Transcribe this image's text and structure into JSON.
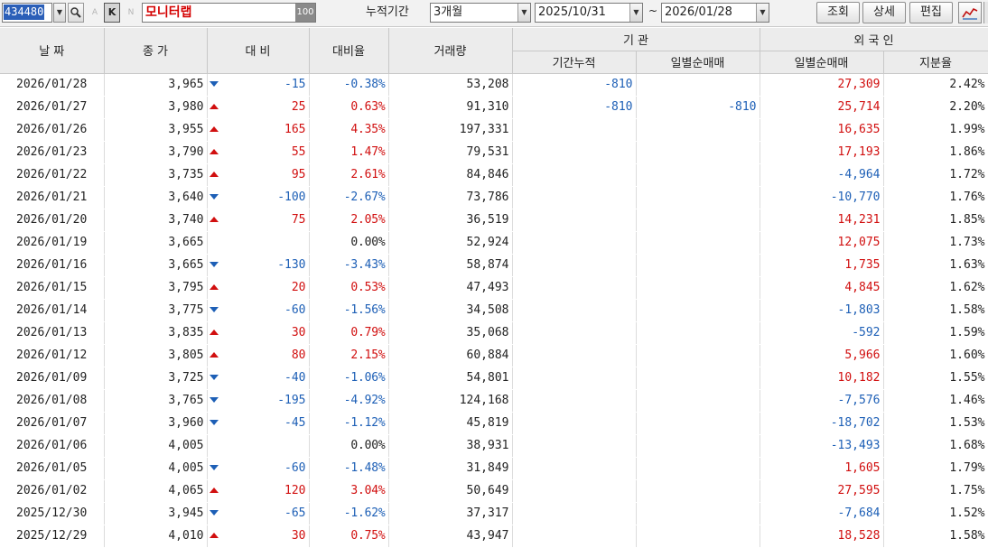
{
  "toolbar": {
    "stock_code": "434480",
    "stock_name": "모니터랩",
    "zoom": "100",
    "ghost_a": "A",
    "k_label": "K",
    "ghost_n": "N",
    "period_label": "누적기간",
    "period_value": "3개월",
    "date_from": "2025/10/31",
    "date_to": "2026/01/28",
    "tilde": "~",
    "btn_search": "조회",
    "btn_detail": "상세",
    "btn_edit": "편집"
  },
  "headers": {
    "date": "날 짜",
    "close": "종 가",
    "change": "대 비",
    "change_rate": "대비율",
    "volume": "거래량",
    "institution": "기 관",
    "inst_cumulative": "기간누적",
    "inst_daily": "일별순매매",
    "foreign": "외 국 인",
    "foreign_daily": "일별순매매",
    "foreign_ratio": "지분율"
  },
  "colors": {
    "up": "#d10f0f",
    "down": "#1d5fb6"
  },
  "rows": [
    {
      "date": "2026/01/28",
      "close": "3,965",
      "dir": "down",
      "change": "-15",
      "rate": "-0.38%",
      "volume": "53,208",
      "inst_cum": "-810",
      "inst_daily": "",
      "frgn_daily": "27,309",
      "frgn_dir": "up",
      "frgn_ratio": "2.42%"
    },
    {
      "date": "2026/01/27",
      "close": "3,980",
      "dir": "up",
      "change": "25",
      "rate": "0.63%",
      "volume": "91,310",
      "inst_cum": "-810",
      "inst_daily": "-810",
      "frgn_daily": "25,714",
      "frgn_dir": "up",
      "frgn_ratio": "2.20%"
    },
    {
      "date": "2026/01/26",
      "close": "3,955",
      "dir": "up",
      "change": "165",
      "rate": "4.35%",
      "volume": "197,331",
      "inst_cum": "",
      "inst_daily": "",
      "frgn_daily": "16,635",
      "frgn_dir": "up",
      "frgn_ratio": "1.99%"
    },
    {
      "date": "2026/01/23",
      "close": "3,790",
      "dir": "up",
      "change": "55",
      "rate": "1.47%",
      "volume": "79,531",
      "inst_cum": "",
      "inst_daily": "",
      "frgn_daily": "17,193",
      "frgn_dir": "up",
      "frgn_ratio": "1.86%"
    },
    {
      "date": "2026/01/22",
      "close": "3,735",
      "dir": "up",
      "change": "95",
      "rate": "2.61%",
      "volume": "84,846",
      "inst_cum": "",
      "inst_daily": "",
      "frgn_daily": "-4,964",
      "frgn_dir": "down",
      "frgn_ratio": "1.72%"
    },
    {
      "date": "2026/01/21",
      "close": "3,640",
      "dir": "down",
      "change": "-100",
      "rate": "-2.67%",
      "volume": "73,786",
      "inst_cum": "",
      "inst_daily": "",
      "frgn_daily": "-10,770",
      "frgn_dir": "down",
      "frgn_ratio": "1.76%"
    },
    {
      "date": "2026/01/20",
      "close": "3,740",
      "dir": "up",
      "change": "75",
      "rate": "2.05%",
      "volume": "36,519",
      "inst_cum": "",
      "inst_daily": "",
      "frgn_daily": "14,231",
      "frgn_dir": "up",
      "frgn_ratio": "1.85%"
    },
    {
      "date": "2026/01/19",
      "close": "3,665",
      "dir": "flat",
      "change": "",
      "rate": "0.00%",
      "volume": "52,924",
      "inst_cum": "",
      "inst_daily": "",
      "frgn_daily": "12,075",
      "frgn_dir": "up",
      "frgn_ratio": "1.73%"
    },
    {
      "date": "2026/01/16",
      "close": "3,665",
      "dir": "down",
      "change": "-130",
      "rate": "-3.43%",
      "volume": "58,874",
      "inst_cum": "",
      "inst_daily": "",
      "frgn_daily": "1,735",
      "frgn_dir": "up",
      "frgn_ratio": "1.63%"
    },
    {
      "date": "2026/01/15",
      "close": "3,795",
      "dir": "up",
      "change": "20",
      "rate": "0.53%",
      "volume": "47,493",
      "inst_cum": "",
      "inst_daily": "",
      "frgn_daily": "4,845",
      "frgn_dir": "up",
      "frgn_ratio": "1.62%"
    },
    {
      "date": "2026/01/14",
      "close": "3,775",
      "dir": "down",
      "change": "-60",
      "rate": "-1.56%",
      "volume": "34,508",
      "inst_cum": "",
      "inst_daily": "",
      "frgn_daily": "-1,803",
      "frgn_dir": "down",
      "frgn_ratio": "1.58%"
    },
    {
      "date": "2026/01/13",
      "close": "3,835",
      "dir": "up",
      "change": "30",
      "rate": "0.79%",
      "volume": "35,068",
      "inst_cum": "",
      "inst_daily": "",
      "frgn_daily": "-592",
      "frgn_dir": "down",
      "frgn_ratio": "1.59%"
    },
    {
      "date": "2026/01/12",
      "close": "3,805",
      "dir": "up",
      "change": "80",
      "rate": "2.15%",
      "volume": "60,884",
      "inst_cum": "",
      "inst_daily": "",
      "frgn_daily": "5,966",
      "frgn_dir": "up",
      "frgn_ratio": "1.60%"
    },
    {
      "date": "2026/01/09",
      "close": "3,725",
      "dir": "down",
      "change": "-40",
      "rate": "-1.06%",
      "volume": "54,801",
      "inst_cum": "",
      "inst_daily": "",
      "frgn_daily": "10,182",
      "frgn_dir": "up",
      "frgn_ratio": "1.55%"
    },
    {
      "date": "2026/01/08",
      "close": "3,765",
      "dir": "down",
      "change": "-195",
      "rate": "-4.92%",
      "volume": "124,168",
      "inst_cum": "",
      "inst_daily": "",
      "frgn_daily": "-7,576",
      "frgn_dir": "down",
      "frgn_ratio": "1.46%"
    },
    {
      "date": "2026/01/07",
      "close": "3,960",
      "dir": "down",
      "change": "-45",
      "rate": "-1.12%",
      "volume": "45,819",
      "inst_cum": "",
      "inst_daily": "",
      "frgn_daily": "-18,702",
      "frgn_dir": "down",
      "frgn_ratio": "1.53%"
    },
    {
      "date": "2026/01/06",
      "close": "4,005",
      "dir": "flat",
      "change": "",
      "rate": "0.00%",
      "volume": "38,931",
      "inst_cum": "",
      "inst_daily": "",
      "frgn_daily": "-13,493",
      "frgn_dir": "down",
      "frgn_ratio": "1.68%"
    },
    {
      "date": "2026/01/05",
      "close": "4,005",
      "dir": "down",
      "change": "-60",
      "rate": "-1.48%",
      "volume": "31,849",
      "inst_cum": "",
      "inst_daily": "",
      "frgn_daily": "1,605",
      "frgn_dir": "up",
      "frgn_ratio": "1.79%"
    },
    {
      "date": "2026/01/02",
      "close": "4,065",
      "dir": "up",
      "change": "120",
      "rate": "3.04%",
      "volume": "50,649",
      "inst_cum": "",
      "inst_daily": "",
      "frgn_daily": "27,595",
      "frgn_dir": "up",
      "frgn_ratio": "1.75%"
    },
    {
      "date": "2025/12/30",
      "close": "3,945",
      "dir": "down",
      "change": "-65",
      "rate": "-1.62%",
      "volume": "37,317",
      "inst_cum": "",
      "inst_daily": "",
      "frgn_daily": "-7,684",
      "frgn_dir": "down",
      "frgn_ratio": "1.52%"
    },
    {
      "date": "2025/12/29",
      "close": "4,010",
      "dir": "up",
      "change": "30",
      "rate": "0.75%",
      "volume": "43,947",
      "inst_cum": "",
      "inst_daily": "",
      "frgn_daily": "18,528",
      "frgn_dir": "up",
      "frgn_ratio": "1.58%"
    }
  ]
}
